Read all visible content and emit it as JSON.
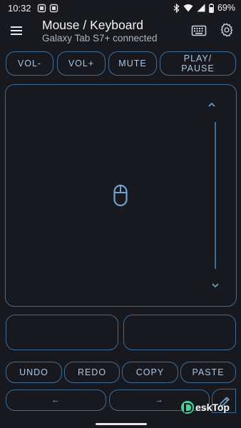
{
  "status_bar": {
    "time": "10:32",
    "battery": "69%"
  },
  "app_bar": {
    "title": "Mouse / Keyboard",
    "subtitle": "Galaxy Tab S7+ connected"
  },
  "media_buttons": [
    {
      "label": "VOL-"
    },
    {
      "label": "VOL+"
    },
    {
      "label": "MUTE"
    },
    {
      "label_line1": "PLAY/",
      "label_line2": "PAUSE"
    }
  ],
  "edit_buttons": [
    {
      "label": "UNDO"
    },
    {
      "label": "REDO"
    },
    {
      "label": "COPY"
    },
    {
      "label": "PASTE"
    }
  ],
  "arrow_buttons": [
    {
      "label": "←"
    },
    {
      "label": "→"
    }
  ],
  "watermark": {
    "text": "eskTop"
  },
  "colors": {
    "background": "#17191e",
    "accent_border": "#3a6f9e",
    "button_text": "#a9c7e4",
    "watermark_green": "#3ed79a"
  },
  "icons": [
    "menu-icon",
    "keyboard-icon",
    "gear-icon",
    "chevron-up-icon",
    "chevron-down-icon",
    "mouse-icon",
    "pencil-icon",
    "wifi-icon",
    "bluetooth-icon",
    "signal-icon",
    "battery-icon"
  ]
}
